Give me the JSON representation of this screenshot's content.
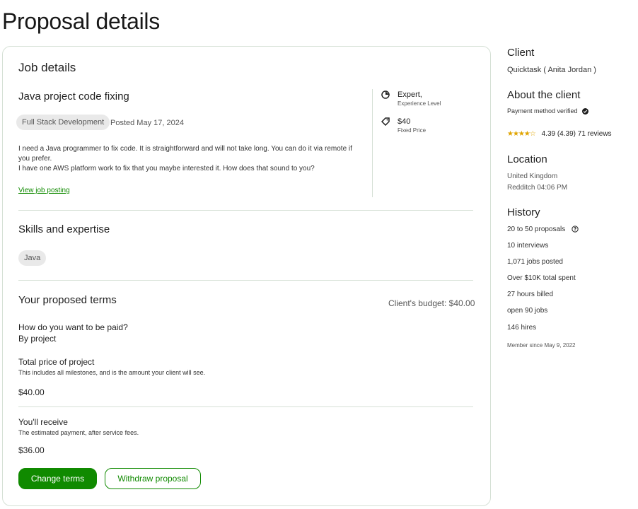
{
  "page_title": "Proposal details",
  "job": {
    "section_title": "Job details",
    "title": "Java project code fixing",
    "category_chip": "Full Stack Development",
    "posted": "Posted May 17, 2024",
    "description_lines": [
      "I need a Java programmer to fix code. It is straightforward and will not take long. You can do it via remote if you prefer.",
      "I have one AWS platform work to fix that you maybe interested it. How does that sound to you?"
    ],
    "view_link": "View job posting",
    "experience_value": "Expert,",
    "experience_label": "Experience Level",
    "price_value": "$40",
    "price_label": "Fixed Price"
  },
  "skills": {
    "title": "Skills and expertise",
    "items": [
      "Java"
    ]
  },
  "terms": {
    "title": "Your proposed terms",
    "budget": "Client's budget: $40.00",
    "paid_question": "How do you want to be paid?",
    "paid_answer": "By project",
    "total_title": "Total price of project",
    "total_desc": "This includes all milestones, and is the amount your client will see.",
    "total_value": "$40.00",
    "receive_title": "You'll receive",
    "receive_desc": "The estimated payment, after service fees.",
    "receive_value": "$36.00",
    "change_button": "Change terms",
    "withdraw_button": "Withdraw proposal"
  },
  "client": {
    "heading": "Client",
    "name": "Quicktask ( Anita Jordan )",
    "about_heading": "About the client",
    "payment_verified": "Payment method verified",
    "rating": 4.39,
    "rating_text": "4.39 (4.39) 71 reviews",
    "location_heading": "Location",
    "country": "United Kingdom",
    "city_time": "Redditch 04:06 PM",
    "history_heading": "History",
    "history": [
      "20 to 50 proposals",
      "10 interviews",
      "1,071 jobs posted",
      "Over $10K total spent",
      "27 hours billed",
      "open 90 jobs",
      "146 hires"
    ],
    "member_since": "Member since May 9, 2022"
  },
  "colors": {
    "accent": "#108a00",
    "border": "#d5e0d5",
    "star": "#e0a400"
  }
}
